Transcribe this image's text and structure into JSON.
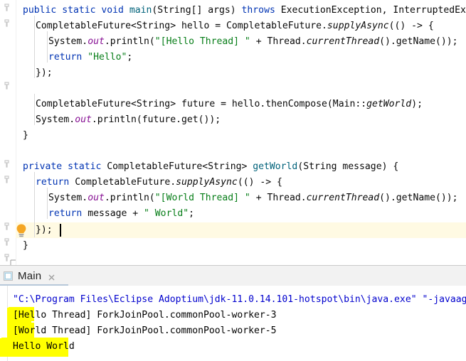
{
  "app": {
    "name": "intellij-idea-editor"
  },
  "editor": {
    "language": "java",
    "current_line_number": 15,
    "caret_after": "});",
    "intention_icon": "lightbulb-icon",
    "lines": [
      {
        "indent": 0,
        "text": "public static void main(String[] args) throws ExecutionException, InterruptedException {"
      },
      {
        "indent": 1,
        "text": "CompletableFuture<String> hello = CompletableFuture.supplyAsync(() -> {"
      },
      {
        "indent": 2,
        "text": "System.out.println(\"[Hello Thread] \" + Thread.currentThread().getName());"
      },
      {
        "indent": 2,
        "text": "return \"Hello\";"
      },
      {
        "indent": 1,
        "text": "});"
      },
      {
        "indent": 0,
        "text": ""
      },
      {
        "indent": 1,
        "text": "CompletableFuture<String> future = hello.thenCompose(Main::getWorld);"
      },
      {
        "indent": 1,
        "text": "System.out.println(future.get());"
      },
      {
        "indent": 0,
        "text": "}"
      },
      {
        "indent": 0,
        "text": ""
      },
      {
        "indent": 0,
        "text": "private static CompletableFuture<String> getWorld(String message) {"
      },
      {
        "indent": 1,
        "text": "return CompletableFuture.supplyAsync(() -> {"
      },
      {
        "indent": 2,
        "text": "System.out.println(\"[World Thread] \" + Thread.currentThread().getName());"
      },
      {
        "indent": 2,
        "text": "return message + \" World\";"
      },
      {
        "indent": 1,
        "text": "});"
      },
      {
        "indent": 0,
        "text": "}"
      }
    ]
  },
  "run_panel": {
    "tab": {
      "label": "Main",
      "icon": "run-configuration-icon",
      "close_icon": "close-icon"
    },
    "console": {
      "lines": [
        {
          "kind": "command",
          "text": "\"C:\\Program Files\\Eclipse Adoptium\\jdk-11.0.14.101-hotspot\\bin\\java.exe\" \"-javaagent:C:\\Prog"
        },
        {
          "kind": "output",
          "text": "[Hello Thread] ForkJoinPool.commonPool-worker-3"
        },
        {
          "kind": "output",
          "text": "[World Thread] ForkJoinPool.commonPool-worker-5"
        },
        {
          "kind": "output",
          "text": "Hello World"
        }
      ],
      "highlights": [
        {
          "label": "hello-token-highlight"
        },
        {
          "label": "world-token-highlight"
        },
        {
          "label": "hello-world-result-highlight"
        }
      ]
    }
  },
  "colors": {
    "keyword": "#0033b3",
    "string": "#067d17",
    "static_field": "#871094",
    "method_decl": "#00627a",
    "console_command": "#0000cd",
    "current_line_bg": "#fffae3",
    "marker_yellow": "#ffff00",
    "bulb_orange": "#f5a623"
  }
}
